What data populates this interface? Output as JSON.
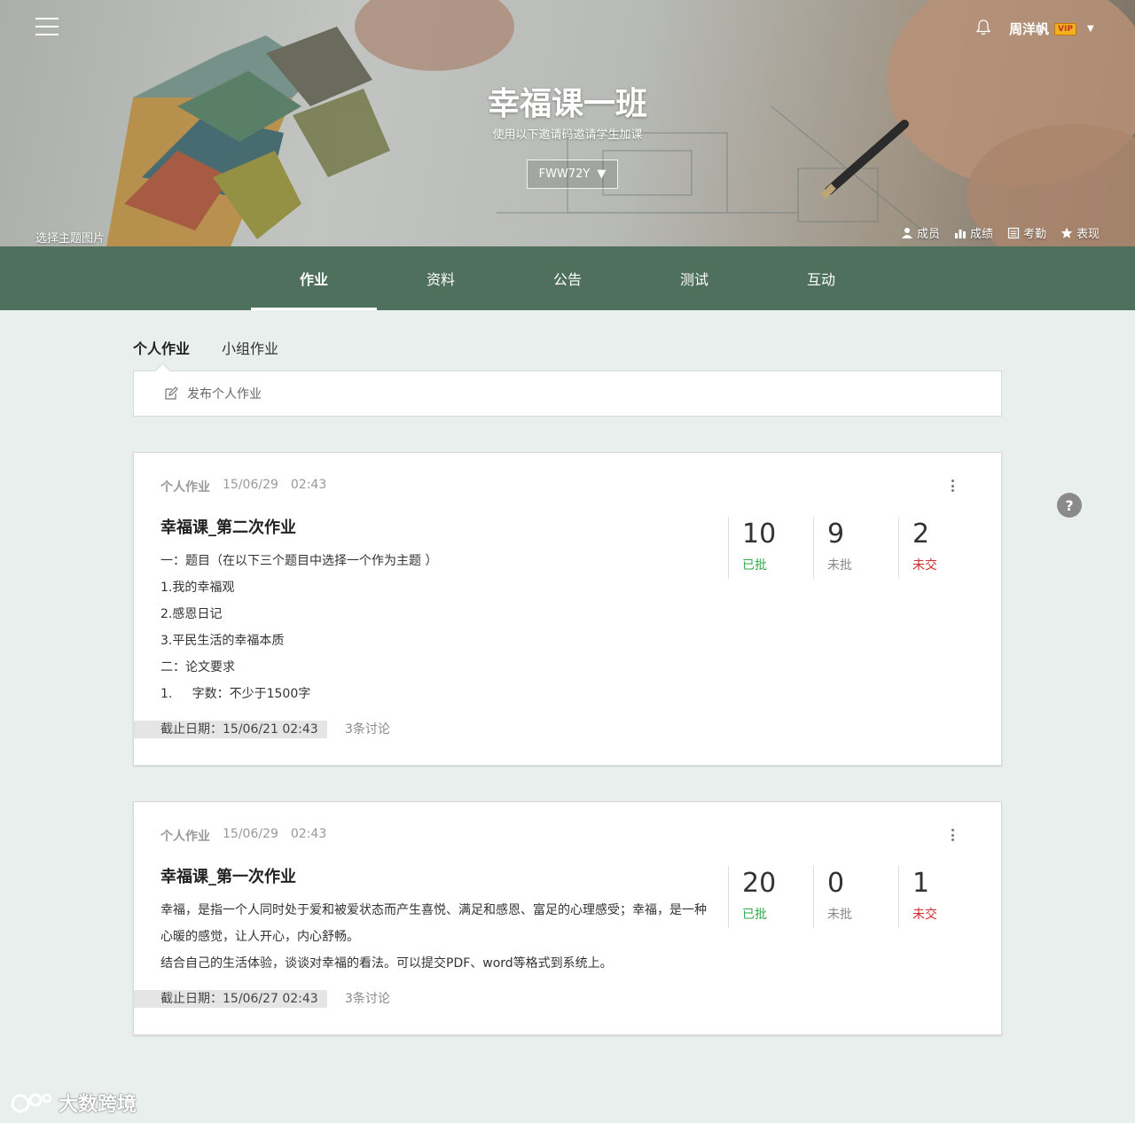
{
  "header": {
    "user_name": "周洋帆",
    "vip_badge": "VIP",
    "class_title": "幸福课一班",
    "invite_hint": "使用以下邀请码邀请学生加课",
    "invite_code": "FWW72Y",
    "choose_theme": "选择主题图片",
    "actions": [
      {
        "label": "成员",
        "icon": "person-icon"
      },
      {
        "label": "成绩",
        "icon": "bar-chart-icon"
      },
      {
        "label": "考勤",
        "icon": "calendar-icon"
      },
      {
        "label": "表现",
        "icon": "star-icon"
      }
    ]
  },
  "tabs": [
    "作业",
    "资料",
    "公告",
    "测试",
    "互动"
  ],
  "active_tab": "作业",
  "subtabs": [
    "个人作业",
    "小组作业"
  ],
  "publish_label": "发布个人作业",
  "assignments": [
    {
      "type": "个人作业",
      "date": "15/06/29",
      "time": "02:43",
      "title": "幸福课_第二次作业",
      "lines": [
        "一：题目（在以下三个题目中选择一个作为主题 ）",
        "1.我的幸福观",
        "2.感恩日记",
        "3.平民生活的幸福本质",
        "二：论文要求",
        "1.     字数：不少于1500字"
      ],
      "stats": {
        "graded": "10",
        "graded_label": "已批",
        "ungraded": "9",
        "ungraded_label": "未批",
        "missing": "2",
        "missing_label": "未交"
      },
      "deadline": "截止日期：15/06/21  02:43",
      "discussions": "3条讨论"
    },
    {
      "type": "个人作业",
      "date": "15/06/29",
      "time": "02:43",
      "title": "幸福课_第一次作业",
      "lines": [
        "幸福，是指一个人同时处于爱和被爱状态而产生喜悦、满足和感恩、富足的心理感受；幸福，是一种心暖的感觉，让人开心，内心舒畅。",
        "结合自己的生活体验，谈谈对幸福的看法。可以提交PDF、word等格式到系统上。"
      ],
      "stats": {
        "graded": "20",
        "graded_label": "已批",
        "ungraded": "0",
        "ungraded_label": "未批",
        "missing": "1",
        "missing_label": "未交"
      },
      "deadline": "截止日期：15/06/27  02:43",
      "discussions": "3条讨论"
    }
  ],
  "help_label": "?",
  "watermark": "大数跨境",
  "colors": {
    "nav_bg": "#50705e",
    "page_bg": "#e9efec",
    "graded": "#2eaa4c",
    "missing": "#d22b2b"
  }
}
